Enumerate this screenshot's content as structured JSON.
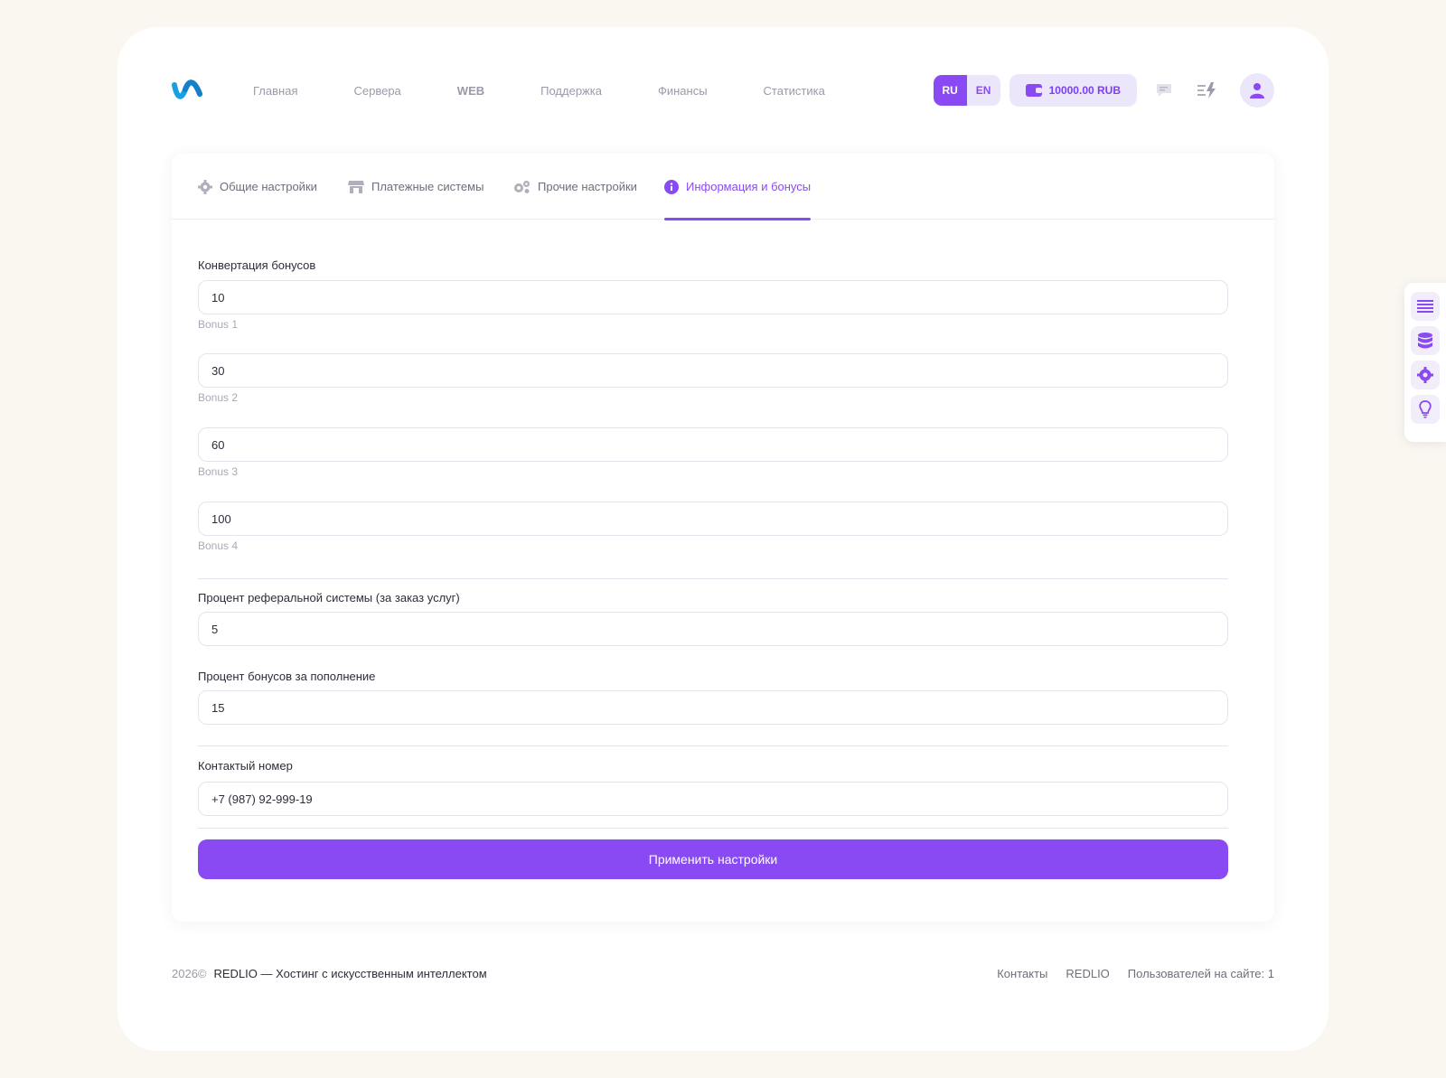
{
  "nav": {
    "items": [
      "Главная",
      "Сервера",
      "WEB",
      "Поддержка",
      "Финансы",
      "Статистика"
    ]
  },
  "header": {
    "lang_ru": "RU",
    "lang_en": "EN",
    "balance": "10000.00 RUB"
  },
  "tabs": [
    {
      "label": "Общие настройки",
      "icon": "gear-icon"
    },
    {
      "label": "Платежные системы",
      "icon": "store-icon"
    },
    {
      "label": "Прочие настройки",
      "icon": "gears-icon"
    },
    {
      "label": "Информация и бонусы",
      "icon": "info-icon",
      "active": true
    }
  ],
  "form": {
    "bonus_label": "Конвертация бонусов",
    "bonuses": [
      {
        "value": "10",
        "hint": "Bonus 1"
      },
      {
        "value": "30",
        "hint": "Bonus 2"
      },
      {
        "value": "60",
        "hint": "Bonus 3"
      },
      {
        "value": "100",
        "hint": "Bonus 4"
      }
    ],
    "referral_label": "Процент реферальной системы (за заказ услуг)",
    "referral_value": "5",
    "topup_label": "Процент бонусов за пополнение",
    "topup_value": "15",
    "phone_label": "Контактый номер",
    "phone_value": "+7 (987) 92-999-19",
    "apply_label": "Применить настройки"
  },
  "footer": {
    "year": "2026©",
    "brand": "REDLIO — Хостинг с искусственным интеллектом",
    "links": [
      "Контакты",
      "REDLIO",
      "Пользователей на сайте: 1"
    ]
  },
  "colors": {
    "accent": "#8a4af3",
    "accent_light": "#ece6fb",
    "background": "#faf6f0"
  }
}
